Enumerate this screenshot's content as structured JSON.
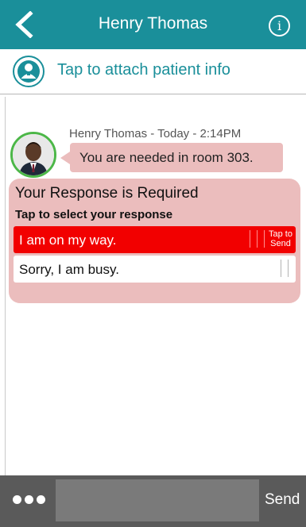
{
  "header": {
    "title": "Henry Thomas",
    "back_icon": "chevron-left-icon",
    "info_icon": "info-icon",
    "info_glyph": "i",
    "color": "#1a8f9a"
  },
  "attach": {
    "label": "Tap to attach patient info",
    "icon": "patient-icon"
  },
  "message": {
    "meta": "Henry Thomas - Today - 2:14PM",
    "text": "You are needed in room 303.",
    "bubble_color": "#ebbdbd",
    "avatar_border": "#4cb748"
  },
  "response": {
    "title": "Your Response is Required",
    "subtitle": "Tap to select your response",
    "options": [
      {
        "label": "I am on my way.",
        "selected": true,
        "hint": [
          "Tap to",
          "Send"
        ]
      },
      {
        "label": "Sorry, I am busy.",
        "selected": false
      }
    ],
    "selected_color": "#f20000"
  },
  "composer": {
    "more_icon": "more-dots-icon",
    "placeholder": "",
    "send_label": "Send"
  }
}
